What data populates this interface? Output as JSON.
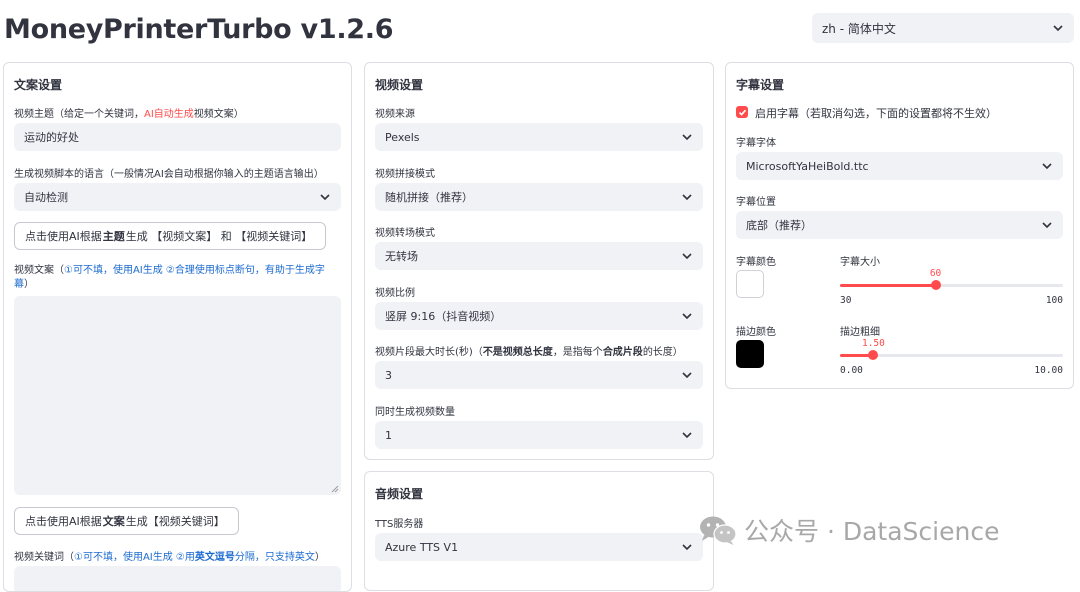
{
  "app_title": "MoneyPrinterTurbo v1.2.6",
  "language_select": {
    "value": "zh - 简体中文"
  },
  "script_panel": {
    "heading": "文案设置",
    "subject_label": {
      "prefix": "视频主题（给定一个关键词，",
      "highlight": "AI自动生成",
      "suffix": "视频文案）"
    },
    "subject_value": "运动的好处",
    "script_lang_label": "生成视频脚本的语言（一般情况AI会自动根据你输入的主题语言输出）",
    "script_lang_value": "自动检测",
    "gen_script_button": {
      "pre": "点击使用AI根据",
      "bold": "主题",
      "post": "生成 【视频文案】 和 【视频关键词】"
    },
    "script_label": {
      "prefix": "视频文案（",
      "line1_blue": "①可不填，使用AI生成 ②合理使用标点断句，有助于生成字",
      "line2_blue": "幕",
      "suffix": "）"
    },
    "script_value": "",
    "gen_keywords_button": {
      "pre": "点击使用AI根据",
      "bold": "文案",
      "post": "生成【视频关键词】"
    },
    "keywords_label": {
      "prefix": "视频关键词（",
      "blue1": "①可不填，使用AI生成 ②用",
      "bold": "英文逗号",
      "blue2": "分隔，只支持英文",
      "suffix": "）"
    }
  },
  "video_panel": {
    "heading": "视频设置",
    "source_label": "视频来源",
    "source_value": "Pexels",
    "concat_label": "视频拼接模式",
    "concat_value": "随机拼接（推荐）",
    "transition_label": "视频转场模式",
    "transition_value": "无转场",
    "ratio_label": "视频比例",
    "ratio_value": "竖屏 9:16（抖音视频）",
    "clip_label": {
      "pre": "视频片段最大时长(秒)（",
      "bold1": "不是视频总长度",
      "mid": "，是指每个",
      "bold2": "合成片段",
      "post": "的长度）"
    },
    "clip_value": "3",
    "count_label": "同时生成视频数量",
    "count_value": "1"
  },
  "audio_panel": {
    "heading": "音频设置",
    "tts_label": "TTS服务器",
    "tts_value": "Azure TTS V1"
  },
  "subtitle_panel": {
    "heading": "字幕设置",
    "enable_label": "启用字幕（若取消勾选，下面的设置都将不生效）",
    "enabled": true,
    "font_label": "字幕字体",
    "font_value": "MicrosoftYaHeiBold.ttc",
    "position_label": "字幕位置",
    "position_value": "底部（推荐）",
    "color_label": "字幕颜色",
    "color_value": "#FFFFFF",
    "size_label": "字幕大小",
    "size": {
      "value": "60",
      "min": "30",
      "max": "100",
      "fraction": 0.4286
    },
    "stroke_color_label": "描边颜色",
    "stroke_color_value": "#000000",
    "stroke_width_label": "描边粗细",
    "stroke_width": {
      "value": "1.50",
      "min": "0.00",
      "max": "10.00",
      "fraction": 0.15
    }
  },
  "watermark": {
    "text": "公众号 · DataScience"
  },
  "colors": {
    "accent": "#ff4b4b",
    "link": "#1c6bd0",
    "field_bg": "#f0f2f6",
    "text": "#31333f"
  }
}
